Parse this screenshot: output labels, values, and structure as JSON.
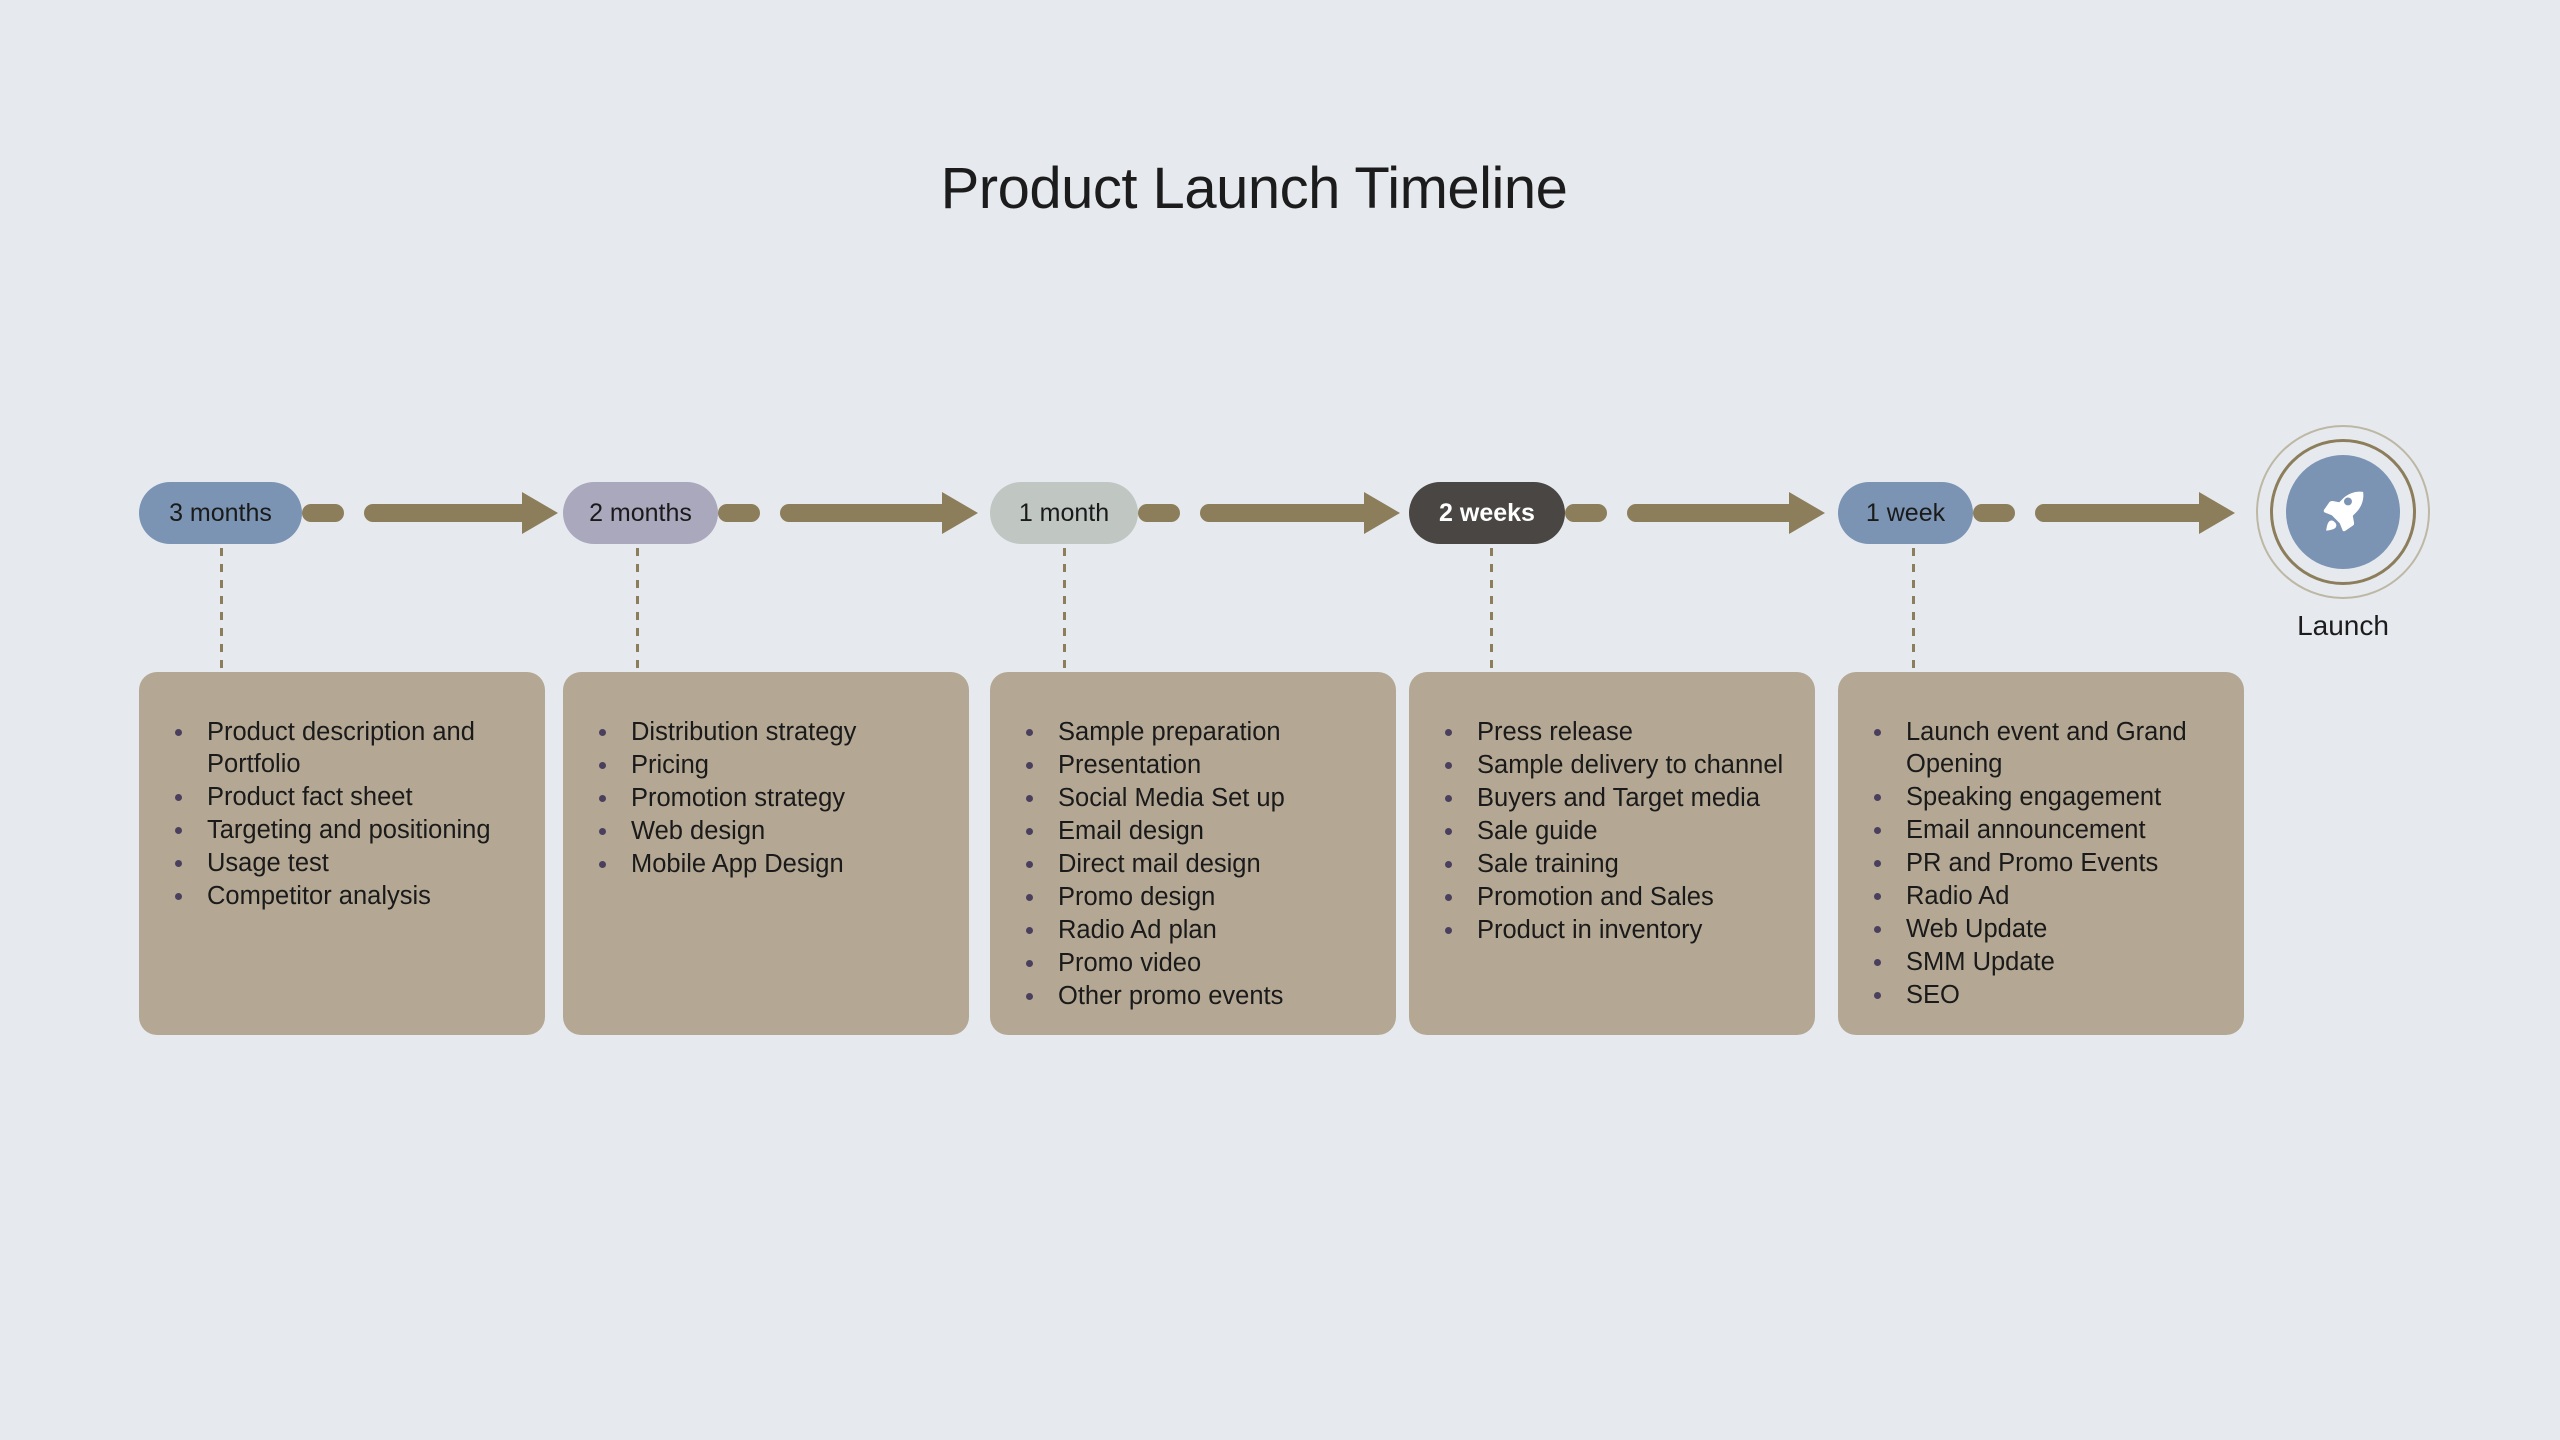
{
  "title": "Product Launch Timeline",
  "colors": {
    "background": "#e6eaef",
    "card_fill": "#b4a894",
    "arrow": "#8c7d5b",
    "bullet": "#4b3f5e",
    "launch_disc": "#7b94b4",
    "ring_outer": "#bdb7a4",
    "ring_inner": "#8c7d5b"
  },
  "launch": {
    "caption": "Launch",
    "icon": "rocket-icon"
  },
  "milestones": [
    {
      "label": "3 months",
      "pill_color": "#7b94b4",
      "text_color": "#1a1a1a",
      "items": [
        "Product description and Portfolio",
        "Product fact sheet",
        "Targeting and positioning",
        "Usage test",
        "Competitor analysis"
      ]
    },
    {
      "label": "2 months",
      "pill_color": "#aaa8bd",
      "text_color": "#1a1a1a",
      "items": [
        "Distribution strategy",
        "Pricing",
        "Promotion strategy",
        "Web design",
        "Mobile App Design"
      ]
    },
    {
      "label": "1 month",
      "pill_color": "#c0c7c3",
      "text_color": "#1a1a1a",
      "items": [
        "Sample preparation",
        "Presentation",
        "Social Media Set up",
        "Email design",
        "Direct mail design",
        "Promo design",
        "Radio Ad plan",
        "Promo video",
        "Other promo events"
      ]
    },
    {
      "label": "2 weeks",
      "pill_color": "#4a4643",
      "text_color": "#ffffff",
      "items": [
        "Press release",
        "Sample delivery to channel",
        "Buyers and Target media",
        "Sale guide",
        "Sale training",
        "Promotion and Sales",
        "Product in inventory"
      ]
    },
    {
      "label": "1 week",
      "pill_color": "#7b94b4",
      "text_color": "#1a1a1a",
      "items": [
        "Launch event and Grand Opening",
        "Speaking engagement",
        "Email announcement",
        "PR and Promo Events",
        "Radio Ad",
        "Web Update",
        "SMM Update",
        "SEO"
      ]
    }
  ],
  "layout": {
    "pill_lefts": [
      139,
      563,
      990,
      1409,
      1838
    ],
    "pill_widths": [
      163,
      155,
      148,
      156,
      135
    ],
    "card_lefts": [
      139,
      563,
      990,
      1409,
      1838
    ],
    "card_widths": [
      406,
      406,
      406,
      406,
      406
    ]
  }
}
